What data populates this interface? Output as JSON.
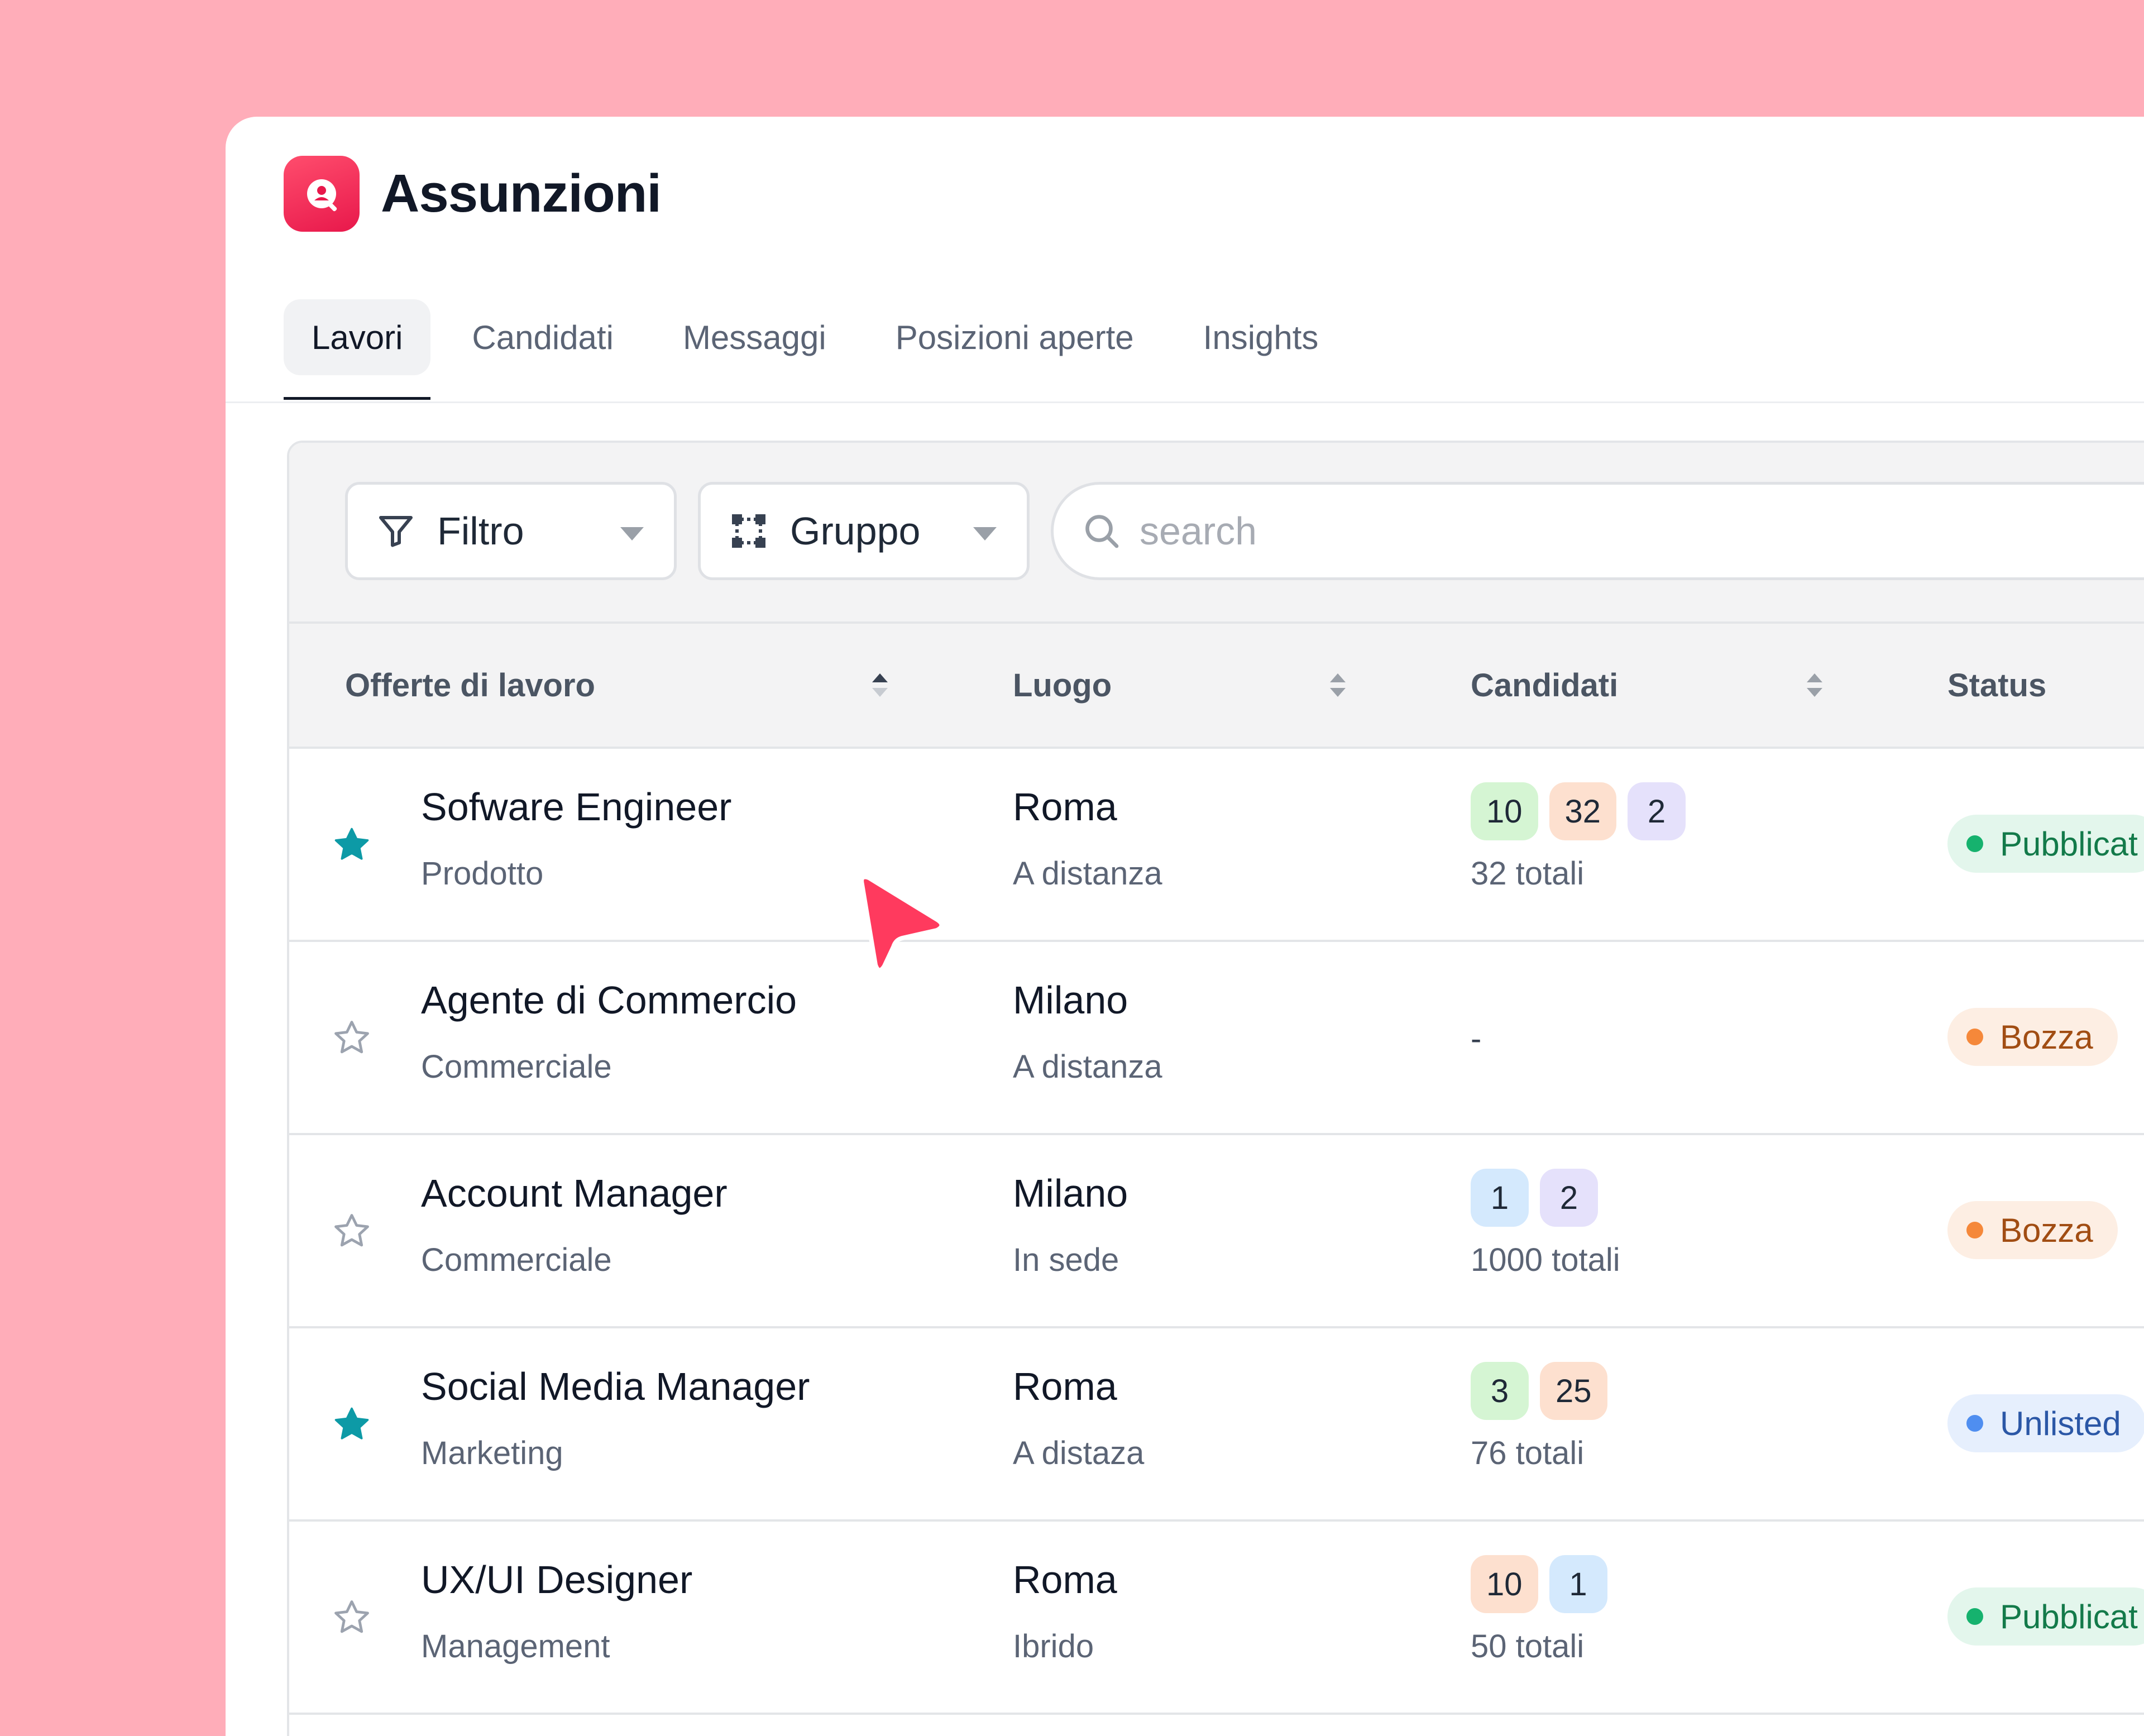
{
  "app": {
    "title": "Assunzioni",
    "logo_icon": "recruiting-person-icon",
    "accent": "#f43b64"
  },
  "tabs": [
    {
      "label": "Lavori",
      "active": true
    },
    {
      "label": "Candidati",
      "active": false
    },
    {
      "label": "Messaggi",
      "active": false
    },
    {
      "label": "Posizioni aperte",
      "active": false
    },
    {
      "label": "Insights",
      "active": false
    }
  ],
  "toolbar": {
    "filter_label": "Filtro",
    "group_label": "Gruppo",
    "search_placeholder": "search"
  },
  "columns": {
    "job": "Offerte di lavoro",
    "location": "Luogo",
    "candidates": "Candidati",
    "status": "Status"
  },
  "rows": [
    {
      "starred": true,
      "title": "Sofware Engineer",
      "department": "Prodotto",
      "city": "Roma",
      "mode": "A distanza",
      "counts": [
        {
          "value": "10",
          "color": "green"
        },
        {
          "value": "32",
          "color": "orange"
        },
        {
          "value": "2",
          "color": "purple"
        }
      ],
      "totals": "32 totali",
      "status": "Pubblicat",
      "status_color": "green"
    },
    {
      "starred": false,
      "title": "Agente di Commercio",
      "department": "Commerciale",
      "city": "Milano",
      "mode": "A distanza",
      "counts": [],
      "empty": "-",
      "totals": "",
      "status": "Bozza",
      "status_color": "orange"
    },
    {
      "starred": false,
      "title": "Account Manager",
      "department": "Commerciale",
      "city": "Milano",
      "mode": "In sede",
      "counts": [
        {
          "value": "1",
          "color": "blue"
        },
        {
          "value": "2",
          "color": "purple"
        }
      ],
      "totals": "1000 totali",
      "status": "Bozza",
      "status_color": "orange"
    },
    {
      "starred": true,
      "title": "Social Media Manager",
      "department": "Marketing",
      "city": "Roma",
      "mode": "A distaza",
      "counts": [
        {
          "value": "3",
          "color": "green"
        },
        {
          "value": "25",
          "color": "orange"
        }
      ],
      "totals": "76 totali",
      "status": "Unlisted",
      "status_color": "blue"
    },
    {
      "starred": false,
      "title": "UX/UI Designer",
      "department": "Management",
      "city": "Roma",
      "mode": "Ibrido",
      "counts": [
        {
          "value": "10",
          "color": "orange"
        },
        {
          "value": "1",
          "color": "blue"
        }
      ],
      "totals": "50 totali",
      "status": "Pubblicat",
      "status_color": "green"
    }
  ],
  "colors": {
    "pill": {
      "green": "#d5f5d3",
      "orange": "#fde0cf",
      "purple": "#e5e1fb",
      "blue": "#d4e9fd"
    },
    "status_bg": {
      "green": "#e3f6ec",
      "orange": "#fdeee3",
      "blue": "#e6effd"
    },
    "status_text": {
      "green": "#137a4a",
      "orange": "#a14d13",
      "blue": "#2b57a6"
    },
    "status_dot": {
      "green": "#16b26e",
      "orange": "#f5883a",
      "blue": "#4f8ef0"
    },
    "star_on": "#0d9aa6",
    "star_off": "#9ca3af"
  },
  "cursor_icon": "pointer-arrow-icon"
}
